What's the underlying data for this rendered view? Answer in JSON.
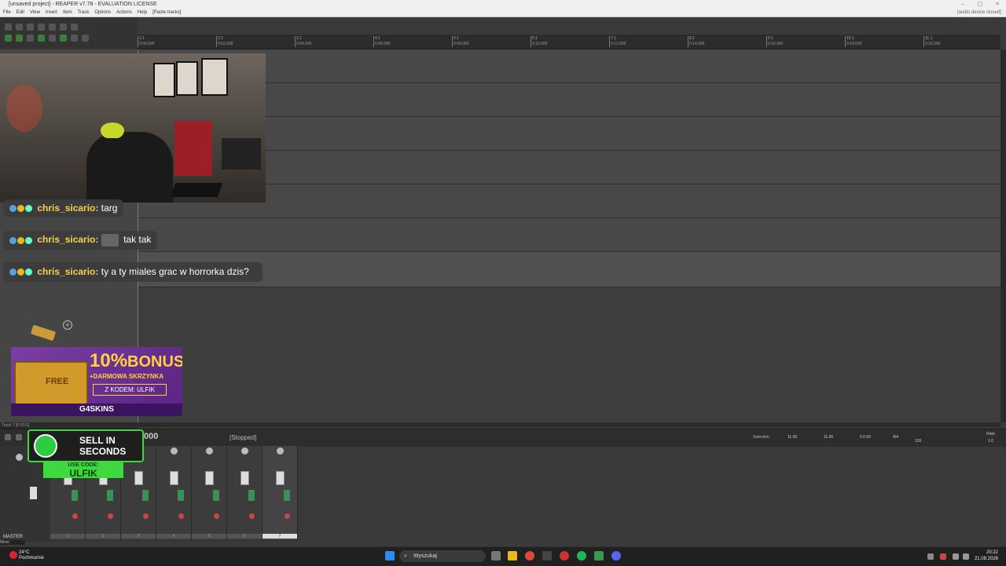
{
  "window": {
    "title": "[unsaved project] - REAPER v7.78 - EVALUATION LICENSE",
    "controls": [
      "–",
      "▢",
      "×"
    ]
  },
  "menubar": {
    "items": [
      "File",
      "Edit",
      "View",
      "Insert",
      "Item",
      "Track",
      "Options",
      "Actions",
      "Help",
      "[Paste tracks]"
    ],
    "status": "[audio device closed]"
  },
  "ruler": {
    "marks": [
      {
        "bar": "1.1",
        "time": "0:00.000"
      },
      {
        "bar": "2.1",
        "time": "0:02.000"
      },
      {
        "bar": "3.1",
        "time": "0:04.000"
      },
      {
        "bar": "4.1",
        "time": "0:06.000"
      },
      {
        "bar": "5.1",
        "time": "0:08.000"
      },
      {
        "bar": "6.1",
        "time": "0:10.000"
      },
      {
        "bar": "7.1",
        "time": "0:12.000"
      },
      {
        "bar": "8.1",
        "time": "0:14.000"
      },
      {
        "bar": "9.1",
        "time": "0:16.000"
      },
      {
        "bar": "10.1",
        "time": "0:18.000"
      },
      {
        "bar": "11.1",
        "time": "0:20.000"
      }
    ]
  },
  "track_info": "Track 7 [0 F0:0]",
  "transport": {
    "time_partial": "000",
    "status": "[Stopped]",
    "selection_label": "Selection:",
    "selection_start": "11.00",
    "selection_end": "11.00",
    "selection_length": "0.0.00",
    "time_signature": "4/4",
    "tempo": "120",
    "rate_label": "Rate:",
    "rate_value": "1.0"
  },
  "mixer": {
    "master_label": "MASTER",
    "tab_label": "Mixer",
    "strip_numbers": [
      "1",
      "2",
      "3",
      "4",
      "5",
      "6",
      "7"
    ]
  },
  "chat": {
    "messages": [
      {
        "user": "chris_sicario:",
        "text": "targ"
      },
      {
        "user": "chris_sicario:",
        "text": "tak tak"
      },
      {
        "user": "chris_sicario:",
        "text": "ty a ty miales grac w horrorka dzis?"
      }
    ]
  },
  "promo_g4": {
    "percent": "10%",
    "bonus": "BONUS",
    "free_crate": "+DARMOWA SKRZYNKA",
    "code": "Z KODEM: ULFIK",
    "crate_label": "FREE",
    "brand": "G4SKINS"
  },
  "promo_sell": {
    "line1": "SELL IN",
    "line2": "SECONDS",
    "use_code": "USE CODE:",
    "code": "ULFIK"
  },
  "taskbar": {
    "weather_temp": "24°C",
    "weather_desc": "Pochmurnie",
    "search_placeholder": "Wyszukaj",
    "time": "20:22",
    "date": "21.08.2026"
  },
  "colors": {
    "accent_green": "#3ed93e",
    "chat_username": "#f6d24a",
    "promo_purple": "#7b3fa3",
    "promo_gold": "#ffd23d"
  }
}
